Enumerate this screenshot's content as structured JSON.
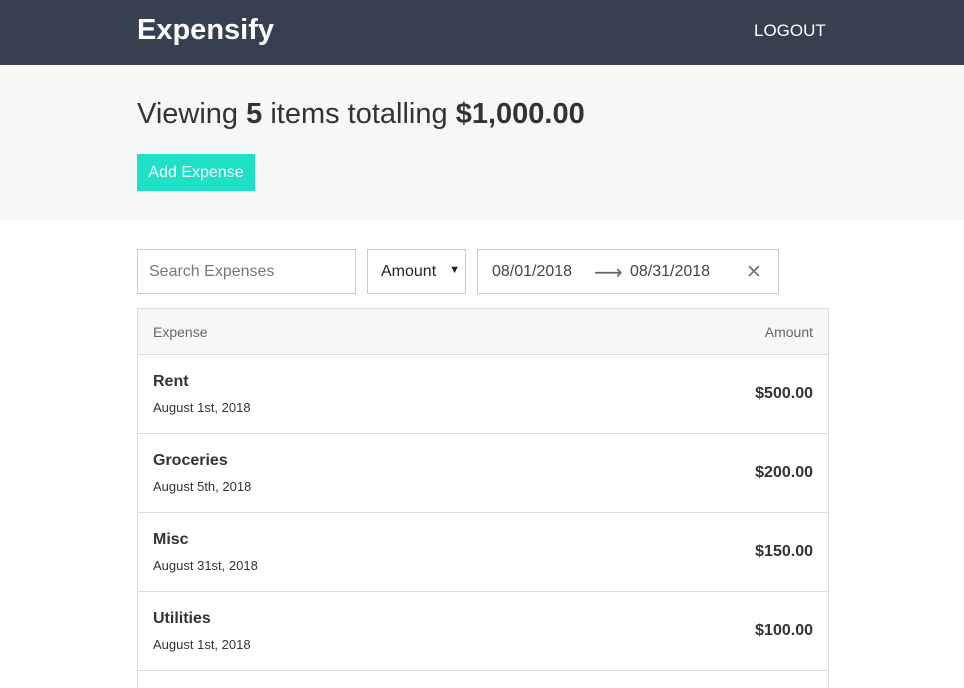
{
  "header": {
    "title": "Expensify",
    "logout_label": "LOGOUT"
  },
  "summary": {
    "prefix": "Viewing",
    "count": "5",
    "middle": "items totalling",
    "total": "$1,000.00",
    "add_label": "Add Expense"
  },
  "filters": {
    "search_placeholder": "Search Expenses",
    "sort_value": "Amount",
    "start_date": "08/01/2018",
    "end_date": "08/31/2018"
  },
  "list": {
    "col_expense": "Expense",
    "col_amount": "Amount",
    "items": [
      {
        "description": "Rent",
        "date": "August 1st, 2018",
        "amount": "$500.00"
      },
      {
        "description": "Groceries",
        "date": "August 5th, 2018",
        "amount": "$200.00"
      },
      {
        "description": "Misc",
        "date": "August 31st, 2018",
        "amount": "$150.00"
      },
      {
        "description": "Utilities",
        "date": "August 1st, 2018",
        "amount": "$100.00"
      }
    ]
  },
  "colors": {
    "header_bg": "#364051",
    "accent": "#1ee0c6",
    "summary_bg": "#f7f7f7"
  }
}
